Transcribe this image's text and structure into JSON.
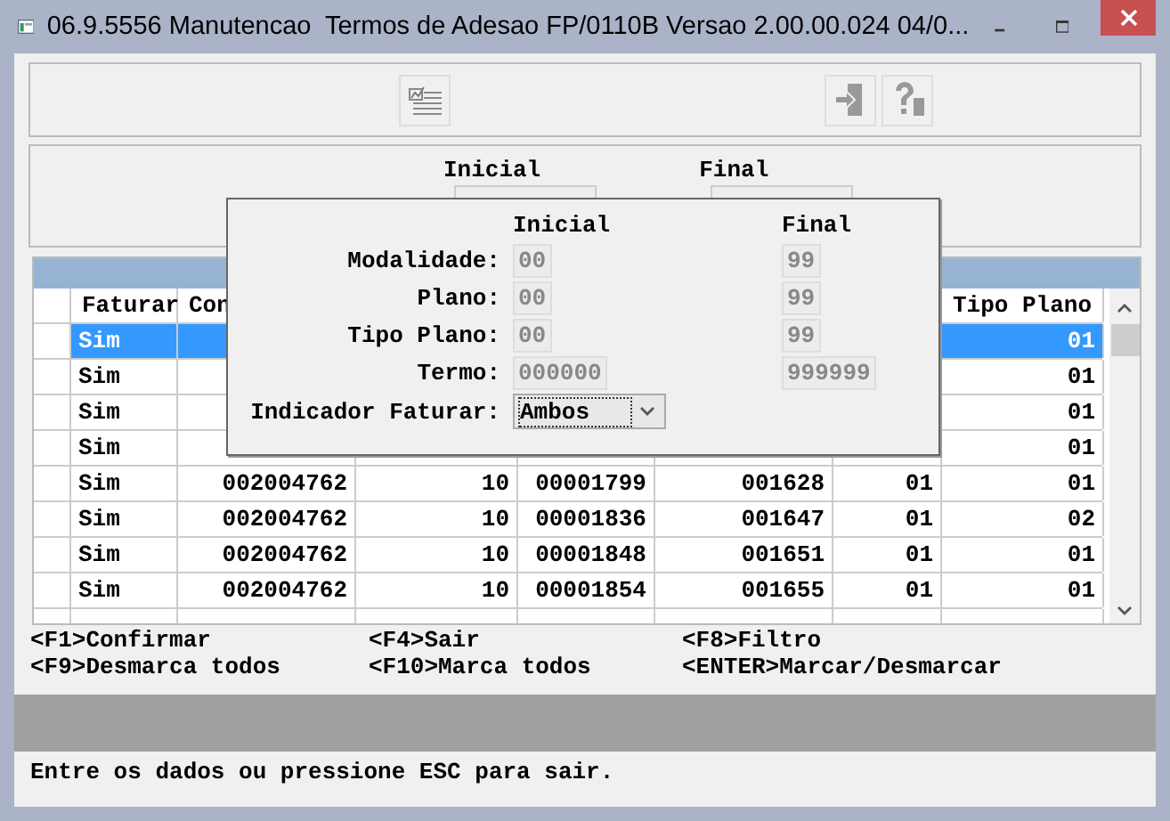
{
  "window": {
    "title": "06.9.5556 Manutencao  Termos de Adesao FP/0110B Versao 2.00.00.024 04/0..."
  },
  "range_header": {
    "initial_label": "Inicial",
    "final_label": "Final"
  },
  "table": {
    "headers": {
      "faturar": "Faturar",
      "column_2": "Con",
      "tipo_plano": "Tipo Plano"
    },
    "rows": [
      {
        "selected": true,
        "faturar": "Sim",
        "tipo_plano": "01"
      },
      {
        "selected": false,
        "faturar": "Sim",
        "tipo_plano": "01"
      },
      {
        "selected": false,
        "faturar": "Sim",
        "tipo_plano": "01"
      },
      {
        "selected": false,
        "faturar": "Sim",
        "tipo_plano": "01"
      },
      {
        "selected": false,
        "faturar": "Sim",
        "column_2": "002004762",
        "column_3": "10",
        "column_4": "00001799",
        "column_5": "001628",
        "column_6": "01",
        "tipo_plano": "01"
      },
      {
        "selected": false,
        "faturar": "Sim",
        "column_2": "002004762",
        "column_3": "10",
        "column_4": "00001836",
        "column_5": "001647",
        "column_6": "01",
        "tipo_plano": "02"
      },
      {
        "selected": false,
        "faturar": "Sim",
        "column_2": "002004762",
        "column_3": "10",
        "column_4": "00001848",
        "column_5": "001651",
        "column_6": "01",
        "tipo_plano": "01"
      },
      {
        "selected": false,
        "faturar": "Sim",
        "column_2": "002004762",
        "column_3": "10",
        "column_4": "00001854",
        "column_5": "001655",
        "column_6": "01",
        "tipo_plano": "01"
      }
    ]
  },
  "function_keys": [
    "<F1>Confirmar",
    "<F4>Sair",
    "<F8>Filtro",
    "<F9>Desmarca todos",
    "<F10>Marca todos",
    "<ENTER>Marcar/Desmarcar"
  ],
  "filter_dialog": {
    "initial_label": "Inicial",
    "final_label": "Final",
    "fields": [
      {
        "label": "Modalidade:",
        "initial": "00",
        "final": "99",
        "disabled": true
      },
      {
        "label": "Plano:",
        "initial": "00",
        "final": "99",
        "disabled": true
      },
      {
        "label": "Tipo Plano:",
        "initial": "00",
        "final": "99",
        "disabled": true
      },
      {
        "label": "Termo:",
        "initial": "000000",
        "final": "999999",
        "disabled": true
      }
    ],
    "dropdown": {
      "label": "Indicador Faturar:",
      "value": "Ambos"
    }
  },
  "status_bar": "Entre os dados ou pressione ESC para sair."
}
